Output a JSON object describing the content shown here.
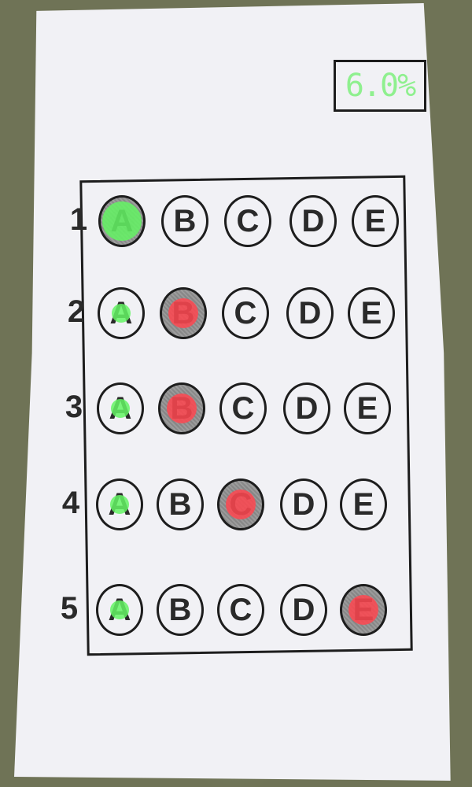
{
  "score": {
    "value": "6.0%",
    "color": "#8ff08f"
  },
  "colors": {
    "correct": "#64f564",
    "incorrect": "#ff4650",
    "ink": "#1d1d1d",
    "paper": "#f1f1f5"
  },
  "choices": [
    "A",
    "B",
    "C",
    "D",
    "E"
  ],
  "questions": [
    {
      "number": "1",
      "marked": "A",
      "correct": "A"
    },
    {
      "number": "2",
      "marked": "B",
      "correct": "A"
    },
    {
      "number": "3",
      "marked": "B",
      "correct": "A"
    },
    {
      "number": "4",
      "marked": "C",
      "correct": "A"
    },
    {
      "number": "5",
      "marked": "E",
      "correct": "A"
    }
  ]
}
